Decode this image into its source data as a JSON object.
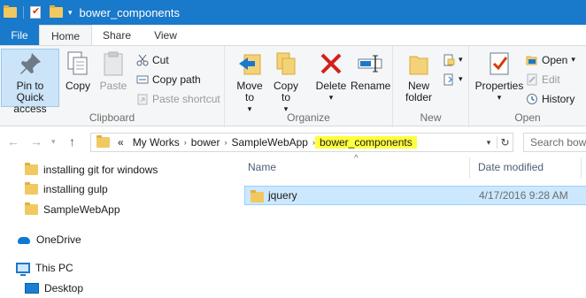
{
  "window": {
    "title": "bower_components"
  },
  "tabs": [
    {
      "label": "File"
    },
    {
      "label": "Home"
    },
    {
      "label": "Share"
    },
    {
      "label": "View"
    }
  ],
  "ribbon": {
    "clipboard": {
      "label": "Clipboard",
      "pin": "Pin to Quick access",
      "copy": "Copy",
      "paste": "Paste",
      "cut": "Cut",
      "copy_path": "Copy path",
      "paste_shortcut": "Paste shortcut"
    },
    "organize": {
      "label": "Organize",
      "move_to": "Move to",
      "copy_to": "Copy to",
      "delete": "Delete",
      "rename": "Rename"
    },
    "new": {
      "label": "New",
      "new_folder": "New folder"
    },
    "open": {
      "label": "Open",
      "properties": "Properties",
      "open": "Open",
      "edit": "Edit",
      "history": "History"
    }
  },
  "address": {
    "prefix": "«",
    "segments": [
      "My Works",
      "bower",
      "SampleWebApp",
      "bower_components"
    ],
    "search_placeholder": "Search bower_components"
  },
  "nav_pane": {
    "items": [
      {
        "label": "installing git for windows"
      },
      {
        "label": "installing gulp"
      },
      {
        "label": "SampleWebApp"
      },
      {
        "label": "OneDrive"
      },
      {
        "label": "This PC"
      },
      {
        "label": "Desktop"
      }
    ]
  },
  "file_list": {
    "columns": {
      "name": "Name",
      "date": "Date modified"
    },
    "rows": [
      {
        "name": "jquery",
        "date": "4/17/2016 9:28 AM"
      }
    ]
  },
  "colors": {
    "accent": "#1979ca",
    "selection": "#cce8ff",
    "highlight": "#ffff3e"
  }
}
